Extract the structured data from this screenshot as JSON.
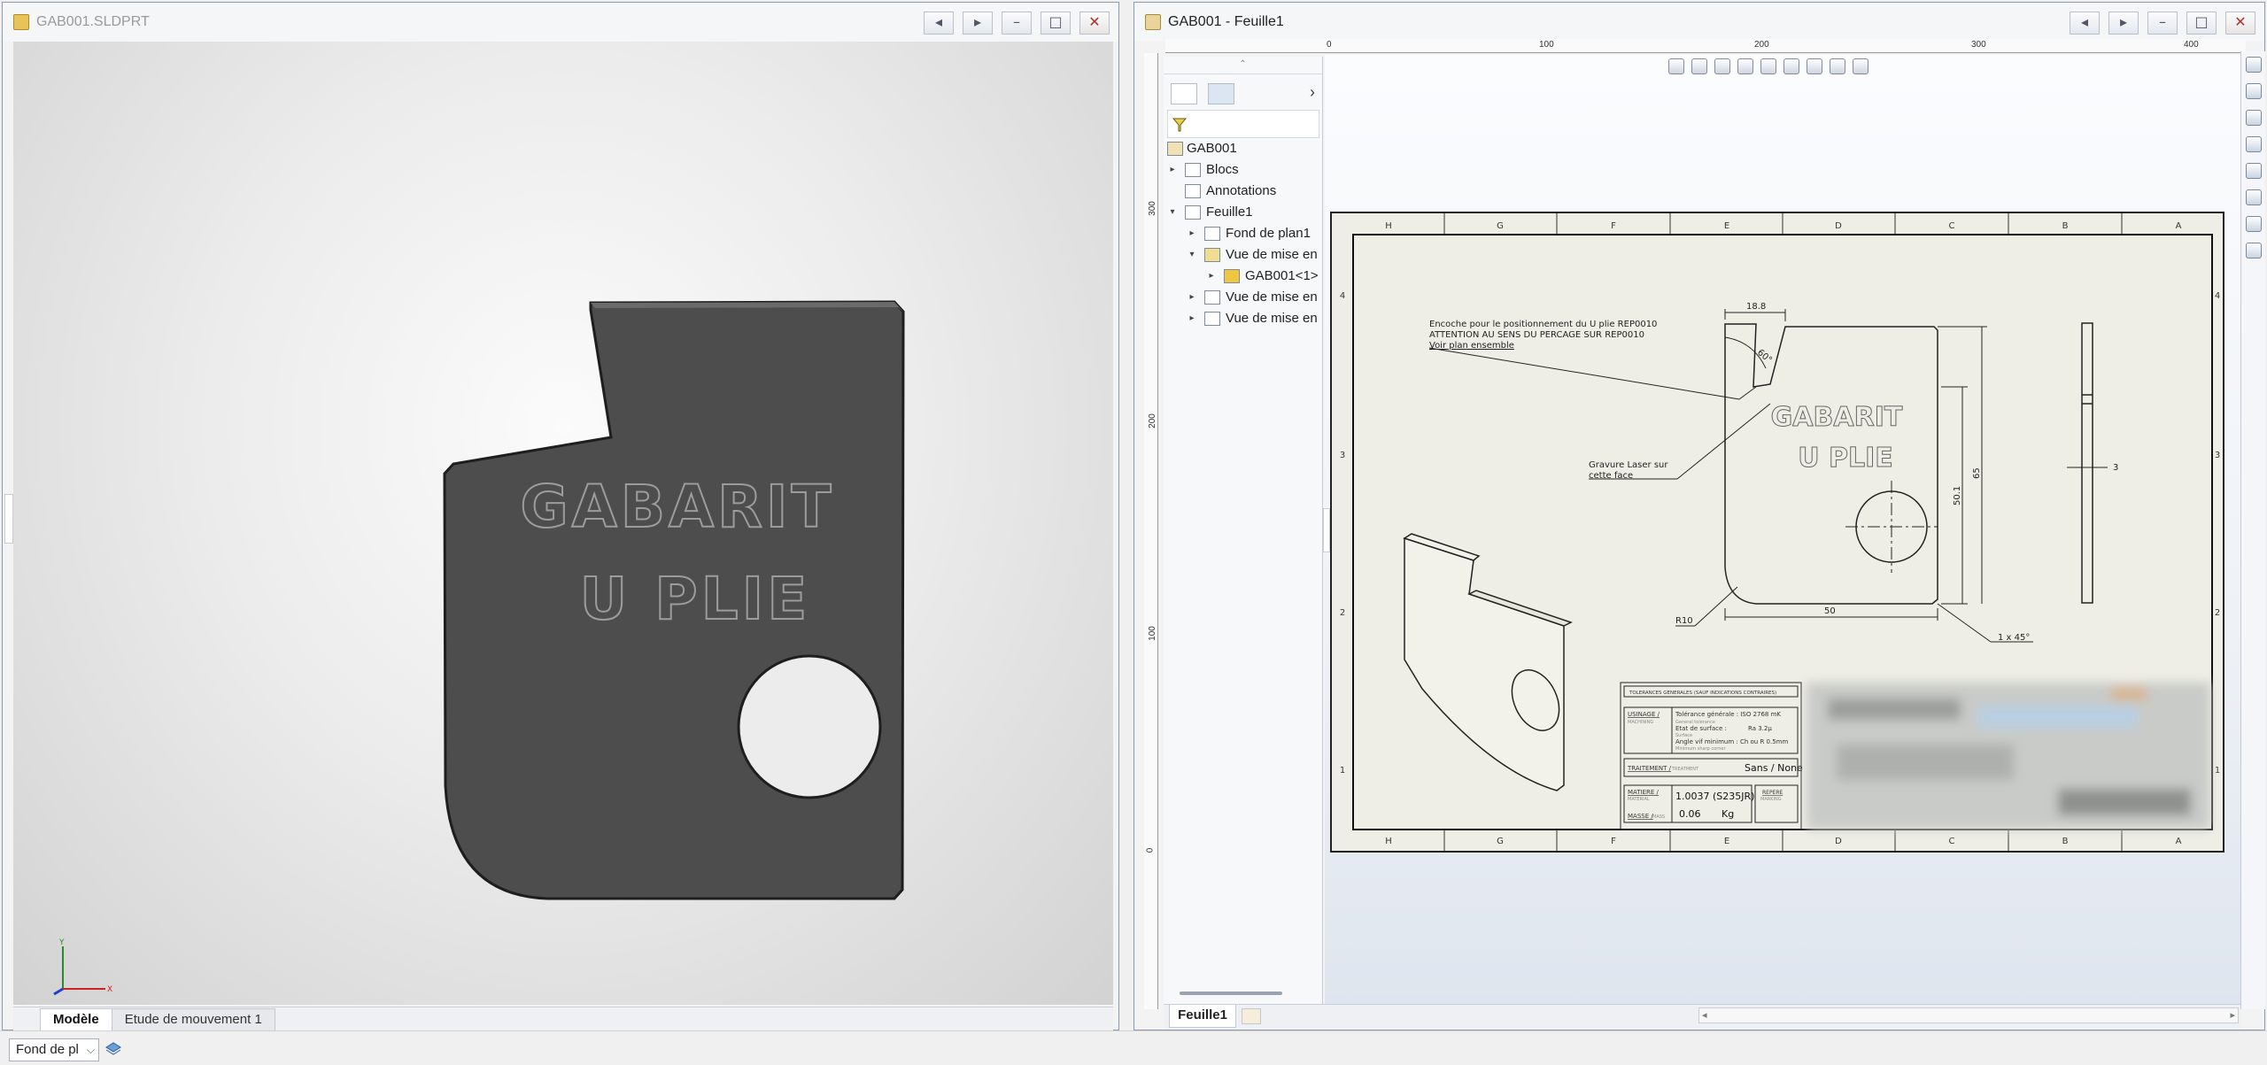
{
  "left_window": {
    "title": "GAB001.SLDPRT",
    "tabs": [
      "Modèle",
      "Etude de mouvement 1"
    ],
    "part_text_line1": "GABARIT",
    "part_text_line2": "U PLIE",
    "triad": {
      "y": "Y",
      "x": "X"
    }
  },
  "right_window": {
    "title": "GAB001 - Feuille1",
    "ruler_h": [
      "0",
      "100",
      "200",
      "300",
      "400"
    ],
    "ruler_v": [
      "300",
      "200",
      "100",
      "0"
    ],
    "tree": [
      {
        "label": "GAB001",
        "level": 0,
        "expander": ""
      },
      {
        "label": "Blocs",
        "level": 1,
        "expander": "▸"
      },
      {
        "label": "Annotations",
        "level": 1,
        "expander": ""
      },
      {
        "label": "Feuille1",
        "level": 1,
        "expander": "▾"
      },
      {
        "label": "Fond de plan1",
        "level": 2,
        "expander": "▸"
      },
      {
        "label": "Vue de mise en",
        "level": 2,
        "expander": "▾"
      },
      {
        "label": "GAB001<1>",
        "level": 3,
        "expander": "▸"
      },
      {
        "label": "Vue de mise en",
        "level": 2,
        "expander": "▸"
      },
      {
        "label": "Vue de mise en",
        "level": 2,
        "expander": "▸"
      }
    ],
    "sheet_tab": "Feuille1"
  },
  "drawing": {
    "zone_cols": [
      "H",
      "G",
      "F",
      "E",
      "D",
      "C",
      "B",
      "A"
    ],
    "zone_rows": [
      "4",
      "3",
      "2",
      "1"
    ],
    "note_line1": "Encoche pour le positionnement du U plie REP0010",
    "note_line2": "ATTENTION AU SENS DU PERCAGE SUR REP0010",
    "note_line3": "Voir plan ensemble",
    "engrave_line1": "Gravure Laser sur",
    "engrave_line2": "cette face",
    "part_text_line1": "GABARIT",
    "part_text_line2": "U PLIE",
    "dims": {
      "top": "18.8",
      "angle": "60°",
      "height_inner": "50.1",
      "height_outer": "65",
      "bottom": "50",
      "radius": "R10",
      "chamfer": "1 x 45°",
      "thickness": "3"
    },
    "title_block": {
      "tolerances": "TOLERANCES GENERALES (SAUF INDICATIONS CONTRAIRES)",
      "usinage": "USINAGE /",
      "usinage_en": "MACHINING",
      "tol_gen": "Tolérance générale : ISO 2768 mK",
      "tol_gen_en": "General tolerance",
      "etat": "Etat de surface :",
      "etat_val": "Ra 3.2µ",
      "etat_en": "Surface",
      "angle_vif": "Angle vif minimum : Ch ou R 0.5mm",
      "angle_vif_en": "Minimum sharp corner",
      "traitement": "TRAITEMENT /",
      "traitement_en": "TREATMENT",
      "traitement_val": "Sans / None",
      "matiere": "MATIERE /",
      "matiere_en": "MATERIAL",
      "matiere_val": "1.0037 (S235JR)",
      "masse": "MASSE /",
      "masse_en": "MASS",
      "masse_val": "0.06",
      "masse_unit": "Kg",
      "repere": "REPERE",
      "repere_en": "MARKING"
    }
  },
  "status": {
    "select_value": "Fond de pl"
  }
}
